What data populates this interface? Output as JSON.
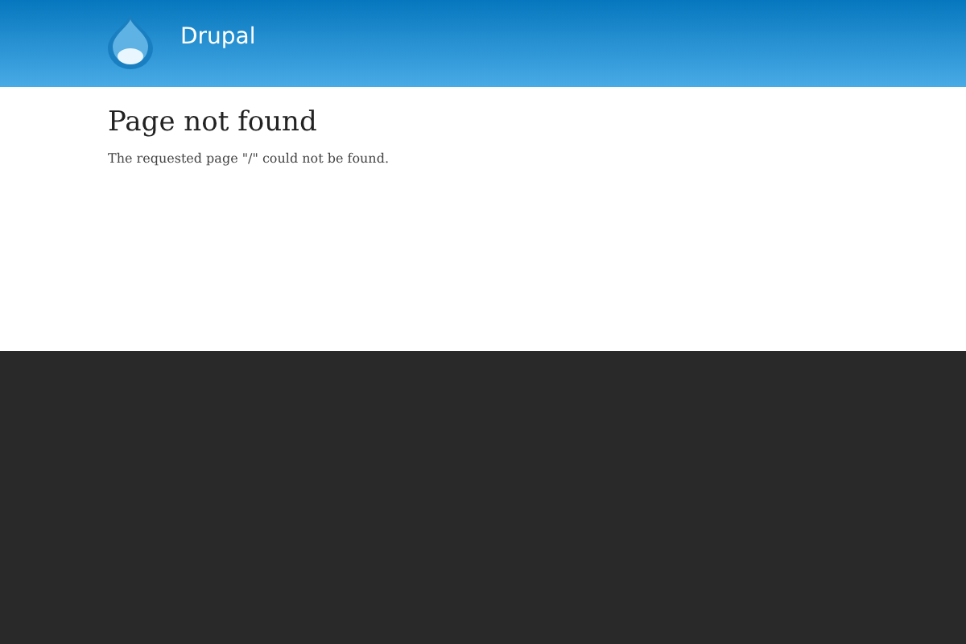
{
  "header": {
    "site_name": "Drupal"
  },
  "content": {
    "title": "Page not found",
    "message": "The requested page \"/\" could not be found."
  }
}
